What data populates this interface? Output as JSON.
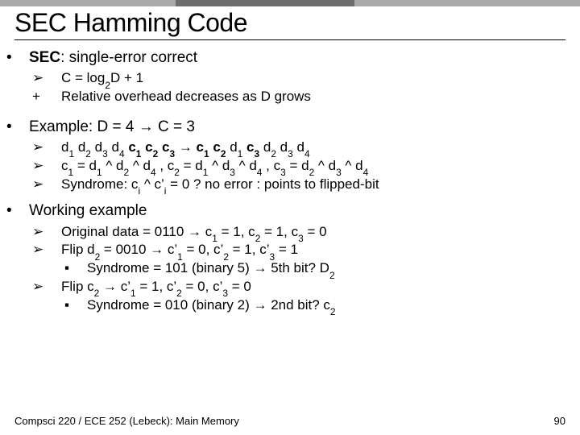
{
  "title": "SEC Hamming Code",
  "sec": {
    "strong": "SEC",
    "rest": ": single-error correct",
    "eq": "C = log",
    "eq_sub": "2",
    "eq_rest": "D + 1",
    "plusline_pre": "+ ",
    "plusline": "Relative overhead decreases as D grows"
  },
  "ex": {
    "heading_a": "Example: D = 4 ",
    "heading_b": " C = 3",
    "seq_a": "d",
    "pos_b": "d",
    "c": "c",
    "arrow": "→",
    "eqline_a": "c",
    "eqline_1": "1",
    "eqline_txt1": " = d",
    "eqline_txt2": " ^ d",
    "eqline_txt3": " ^ d",
    "eqline_txt4": " , c",
    "eqline_2": "2",
    "eqline_txt5": " = d",
    "eqline_txt6": " ^ d",
    "eqline_txt7": " ^ d",
    "eqline_txt8": " , c",
    "eqline_3": "3",
    "eqline_txt9": " = d",
    "eqline_txt10": " ^ d",
    "eqline_txt11": " ^ d",
    "eqline_sub": {
      "one": "1",
      "two": "2",
      "three": "3",
      "four": "4"
    },
    "syndrome_a": "Syndrome: c",
    "syndrome_b": " ^ c’",
    "syndrome_c": " = 0 ? no error : points to flipped-bit",
    "i": "i"
  },
  "work": {
    "heading": "Working example",
    "orig_a": "Original data = 0110 ",
    "orig_b": " c",
    "orig_c": " = 1, c",
    "orig_d": " = 1, c",
    "orig_e": " = 0",
    "flip1_a": "Flip d",
    "flip1_b": " = 0010 ",
    "flip1_c": " c’",
    "flip1_d": " = 0, c’",
    "flip1_e": " = 1, c’",
    "flip1_f": " = 1",
    "syn1_a": "Syndrome = 101 (binary 5) ",
    "syn1_b": " 5th bit? D",
    "flip2_a": "Flip c",
    "flip2_b": " ",
    "flip2_c": " c’",
    "flip2_d": " = 1, c’",
    "flip2_e": " = 0, c’",
    "flip2_f": " = 0",
    "syn2_a": "Syndrome = 010 (binary 2) ",
    "syn2_b": " 2nd bit? c",
    "n": {
      "one": "1",
      "two": "2",
      "three": "3"
    }
  },
  "footer": {
    "left": "Compsci 220 / ECE 252 (Lebeck): Main Memory",
    "page": "90"
  },
  "sym": {
    "dot": "•",
    "tri": "➢",
    "sq": "▪",
    "arr": "→"
  }
}
